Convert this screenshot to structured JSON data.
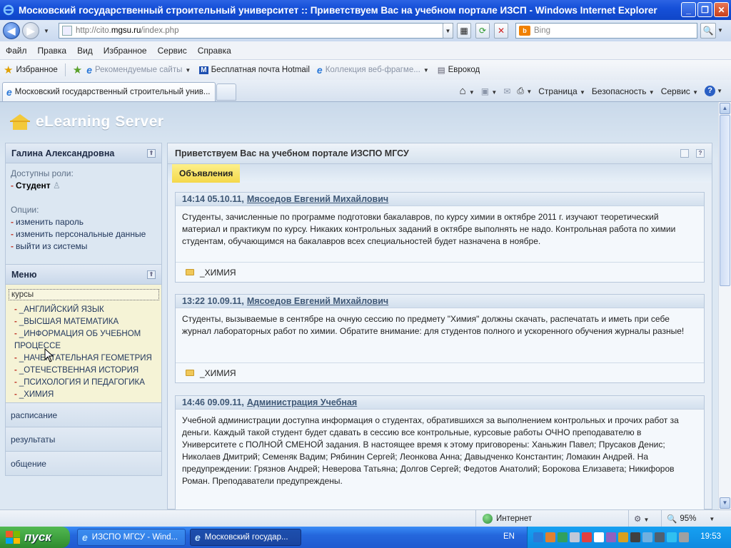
{
  "window": {
    "title": "Московский государственный строительный университет :: Приветствуем Вас на учебном портале ИЗСП - Windows Internet Explorer"
  },
  "address": {
    "url_prefix": "http://cito.",
    "url_host": "mgsu.ru",
    "url_path": "/index.php",
    "search_placeholder": "Bing"
  },
  "menu": [
    "Файл",
    "Правка",
    "Вид",
    "Избранное",
    "Сервис",
    "Справка"
  ],
  "favorites": {
    "label": "Избранное",
    "items": [
      {
        "label": "Рекомендуемые сайты",
        "dim": true
      },
      {
        "label": "Бесплатная почта Hotmail",
        "dim": false
      },
      {
        "label": "Коллекция веб-фрагме...",
        "dim": true
      },
      {
        "label": "Еврокод",
        "dim": false
      }
    ]
  },
  "tabs": {
    "active_label": "Московский государственный строительный унив..."
  },
  "commandbar": {
    "page": "Страница",
    "safety": "Безопасность",
    "tools": "Сервис"
  },
  "site": {
    "logo_text": "eLearning Server"
  },
  "user": {
    "name": "Галина  Александровна",
    "roles_label": "Доступны роли:",
    "role": "Студент",
    "options_label": "Опции:",
    "options": [
      "изменить пароль",
      "изменить персональные данные",
      "выйти из системы"
    ]
  },
  "left_menu": {
    "title": "Меню",
    "courses_label": "курсы",
    "courses": [
      "_АНГЛИЙСКИЙ ЯЗЫК",
      "_ВЫСШАЯ МАТЕМАТИКА",
      "_ИНФОРМАЦИЯ ОБ УЧЕБНОМ ПРОЦЕССЕ",
      "_НАЧЕРТАТЕЛЬНАЯ ГЕОМЕТРИЯ",
      "_ОТЕЧЕСТВЕННАЯ ИСТОРИЯ",
      "_ПСИХОЛОГИЯ И ПЕДАГОГИКА",
      "_ХИМИЯ"
    ],
    "links": [
      "расписание",
      "результаты",
      "общение"
    ]
  },
  "main": {
    "title": "Приветствуем Вас на учебном портале ИЗСПО МГСУ",
    "tab_label": "Объявления",
    "announcements": [
      {
        "datetime": "14:14 05.10.11,",
        "author": "Мясоедов Евгений Михайлович",
        "text": "Студенты, зачисленные по программе подготовки бакалавров, по курсу химии в октябре 2011 г. изучают теоретический материал и практикум по курсу. Никаких контрольных заданий в октябре выполнять не надо. Контрольная работа по химии студентам, обучающимся на бакалавров всех специальностей будет назначена в ноябре.",
        "course": "_ХИМИЯ"
      },
      {
        "datetime": "13:22 10.09.11,",
        "author": "Мясоедов Евгений Михайлович",
        "text": "Студенты, вызываемые в сентябре на очную сессию по предмету \"Химия\" должны скачать, распечатать и иметь при себе журнал лабораторных работ по химии. Обратите внимание: для студентов полного и ускоренного обучения журналы разные!",
        "course": "_ХИМИЯ"
      },
      {
        "datetime": "14:46 09.09.11,",
        "author": "Администрация Учебная",
        "text": "Учебной администрации доступна информация о студентах, обратившихся за выполнением контрольных и прочих работ за деньги. Каждый такой студент будет сдавать в сессию все контрольные, курсовые работы ОЧНО преподавателю в Университете с ПОЛНОЙ СМЕНОЙ задания. В настоящее время к этому приговорены: Ханьжин Павел; Прусаков Денис; Николаев Дмитрий; Семеняк Вадим; Рябинин Сергей; Леонкова Анна; Давыдченко Константин; Ломакин Андрей. На предупреждении: Грязнов Андрей; Неверова Татьяна; Долгов Сергей; Федотов Анатолий; Борокова Елизавета; Никифоров Роман. Преподаватели предупреждены."
      }
    ]
  },
  "status": {
    "zone": "Интернет",
    "zoom": "95%"
  },
  "taskbar": {
    "start": "пуск",
    "buttons": [
      "ИЗСПО МГСУ - Wind...",
      "Московский государ..."
    ],
    "lang": "EN",
    "clock": "19:53"
  }
}
